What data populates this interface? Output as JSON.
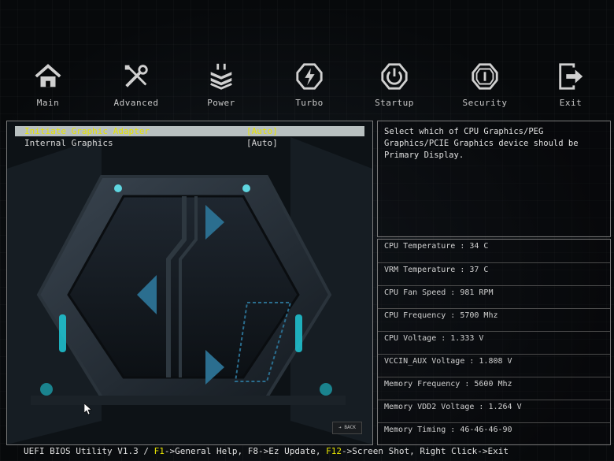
{
  "nav": {
    "items": [
      {
        "label": "Main",
        "icon": "home-icon"
      },
      {
        "label": "Advanced",
        "icon": "tools-icon"
      },
      {
        "label": "Power",
        "icon": "power-stack-icon"
      },
      {
        "label": "Turbo",
        "icon": "turbo-bolt-icon"
      },
      {
        "label": "Startup",
        "icon": "startup-power-icon"
      },
      {
        "label": "Security",
        "icon": "security-shield-icon"
      },
      {
        "label": "Exit",
        "icon": "exit-door-icon"
      }
    ]
  },
  "menu": {
    "rows": [
      {
        "label": "Initiate Graphic Adapter",
        "value": "[Auto]"
      },
      {
        "label": "Internal Graphics",
        "value": "[Auto]"
      }
    ],
    "back_label": "BACK"
  },
  "help": {
    "text": "Select which of CPU Graphics/PEG Graphics/PCIE Graphics device should be Primary Display."
  },
  "status": {
    "items": [
      "CPU Temperature : 34 C",
      "VRM Temperature : 37 C",
      "CPU Fan Speed : 981 RPM",
      "CPU Frequency : 5700 Mhz",
      "CPU Voltage : 1.333 V",
      "VCCIN_AUX Voltage : 1.808 V",
      "Memory Frequency : 5600 Mhz",
      "Memory VDD2 Voltage : 1.264 V",
      "Memory Timing : 46-46-46-90"
    ]
  },
  "footer": {
    "prefix": "UEFI BIOS Utility V1.3 / ",
    "f1": "F1",
    "f1_text": "->General Help, F8->Ez Update, ",
    "f12": "F12",
    "f12_text": "->Screen Shot, Right Click->Exit"
  },
  "colors": {
    "accent": "#e7e400",
    "highlight_bg": "#b8c0c0",
    "border": "#7a7a7a",
    "teal": "#2fd0d8"
  }
}
